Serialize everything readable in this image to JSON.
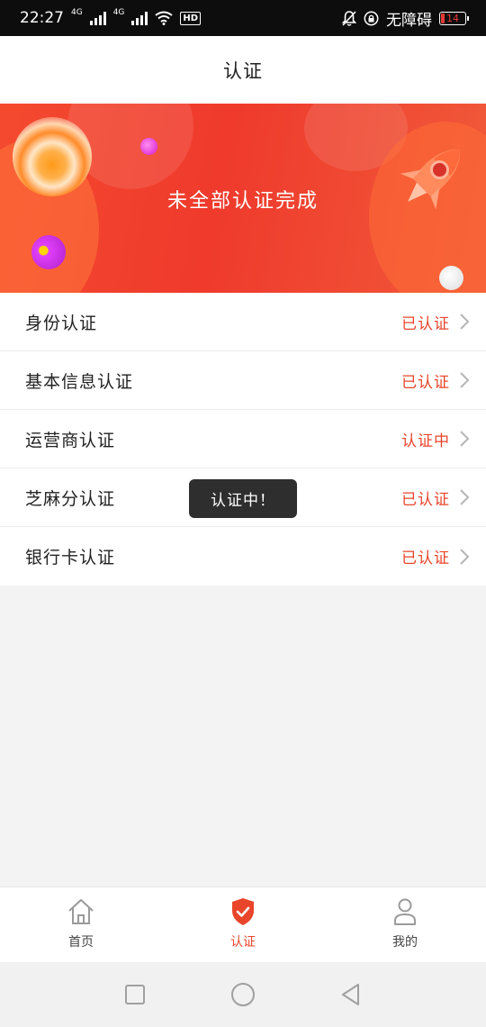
{
  "status_bar": {
    "time": "22:27",
    "network1": "4G",
    "network2": "4G",
    "hd": "HD",
    "accessibility": "无障碍",
    "battery": "14",
    "battery_color": "#e53935"
  },
  "header": {
    "title": "认证"
  },
  "banner": {
    "text": "未全部认证完成",
    "background_color": "#ef3a2c",
    "icon": "rocket-icon"
  },
  "items": [
    {
      "label": "身份认证",
      "status": "已认证"
    },
    {
      "label": "基本信息认证",
      "status": "已认证"
    },
    {
      "label": "运营商认证",
      "status": "认证中"
    },
    {
      "label": "芝麻分认证",
      "status": "已认证"
    },
    {
      "label": "银行卡认证",
      "status": "已认证"
    }
  ],
  "toast": {
    "text": "认证中！"
  },
  "tabs": [
    {
      "label": "首页",
      "icon": "home-icon",
      "active": false
    },
    {
      "label": "认证",
      "icon": "shield-check-icon",
      "active": true
    },
    {
      "label": "我的",
      "icon": "user-icon",
      "active": false
    }
  ],
  "colors": {
    "accent": "#e9452b",
    "background": "#f3f3f3"
  },
  "system_nav": {
    "icons": [
      "recent-apps-icon",
      "home-circle-icon",
      "back-triangle-icon"
    ]
  }
}
